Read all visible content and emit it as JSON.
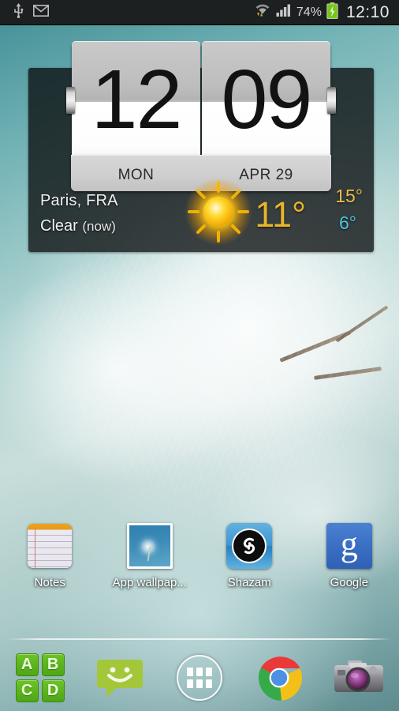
{
  "statusbar": {
    "left_icons": [
      {
        "name": "usb-icon",
        "label": "USB connected"
      },
      {
        "name": "gmail-icon",
        "label": "Gmail"
      }
    ],
    "right_icons": [
      {
        "name": "wifi-icon",
        "label": "Wi-Fi with data transfer"
      },
      {
        "name": "signal-bars-icon",
        "label": "Mobile signal"
      },
      {
        "name": "battery-charging-icon",
        "label": "Battery charging"
      }
    ],
    "battery_percent": "74%",
    "clock": "12:10"
  },
  "widget": {
    "name": "flip-clock-weather-widget",
    "clock": {
      "hours": "12",
      "minutes": "09",
      "weekday": "MON",
      "date": "APR 29"
    },
    "weather": {
      "location": "Paris, FRA",
      "condition": "Clear",
      "condition_time": "(now)",
      "icon": "sun-icon",
      "current_temp": "11°",
      "high_temp": "15°",
      "low_temp": "6°",
      "high_color": "#e8c14a",
      "low_color": "#4cc6e0",
      "current_color": "#e8b52b"
    }
  },
  "apps": [
    {
      "label": "Notes",
      "icon": "notes-icon",
      "name": "app-notes"
    },
    {
      "label": "App wallpap...",
      "icon": "app-wallpaper-icon",
      "name": "app-app-wallpaper"
    },
    {
      "label": "Shazam",
      "icon": "shazam-icon",
      "name": "app-shazam"
    },
    {
      "label": "Google",
      "icon": "google-icon",
      "name": "app-google"
    }
  ],
  "dock": [
    {
      "name": "dock-item-abcd",
      "icon": "abcd-tiles-icon",
      "tiles": [
        "A",
        "B",
        "C",
        "D"
      ]
    },
    {
      "name": "dock-item-messaging",
      "icon": "messaging-smiley-icon"
    },
    {
      "name": "dock-item-app-drawer",
      "icon": "app-drawer-grid-icon"
    },
    {
      "name": "dock-item-chrome",
      "icon": "chrome-icon"
    },
    {
      "name": "dock-item-camera",
      "icon": "camera-icon"
    }
  ]
}
